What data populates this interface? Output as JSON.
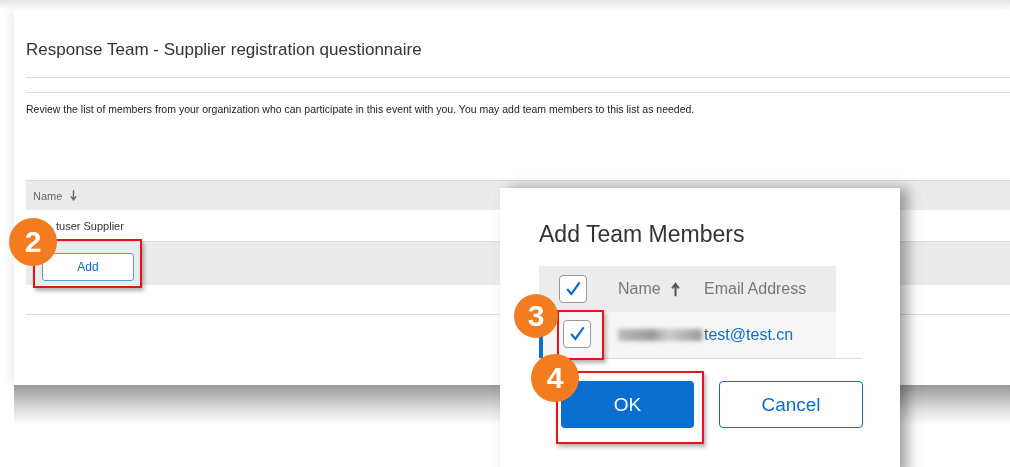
{
  "page": {
    "title": "Response Team - Supplier registration questionnaire",
    "description": "Review the list of members from your organization who can participate in this event with you. You may add team members to this list as needed.",
    "table": {
      "columns": [
        {
          "label": "Name",
          "sorted": true,
          "sort_ascending": false
        }
      ],
      "rows": [
        {
          "name": "tuser Supplier"
        }
      ],
      "add_button": "Add"
    }
  },
  "dialog": {
    "title": "Add Team Members",
    "select_all_checked": true,
    "columns": [
      {
        "label": "Name",
        "sorted": true,
        "sort_ascending": true
      },
      {
        "label": "Email Address",
        "sorted": false
      }
    ],
    "rows": [
      {
        "email": "test@test.cn",
        "checked": true,
        "selected": true,
        "name_redacted": true
      }
    ],
    "buttons": [
      {
        "label": "OK",
        "kind": "primary"
      },
      {
        "label": "Cancel",
        "kind": "secondary"
      }
    ]
  },
  "callouts": [
    {
      "number": "2"
    },
    {
      "number": "3"
    },
    {
      "number": "4"
    }
  ]
}
